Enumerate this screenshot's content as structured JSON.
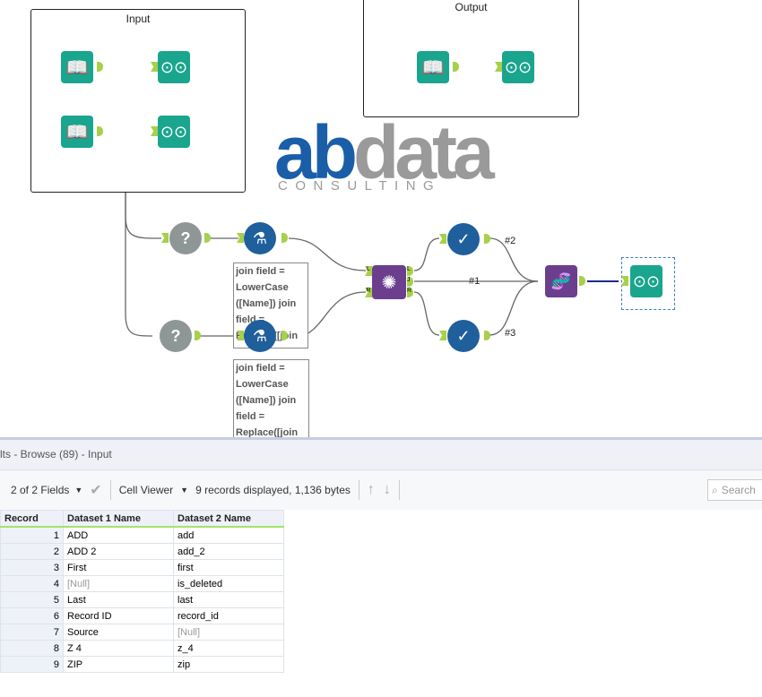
{
  "canvas": {
    "containers": [
      {
        "title": "Input"
      },
      {
        "title": "Output"
      }
    ],
    "logo": {
      "text1": "ab",
      "text2": "data",
      "sub": "CONSULTING"
    },
    "annotations": [
      "join field = LowerCase ([Name]) join field = Replace([join field],\" \",\"\")",
      "join field = LowerCase ([Name]) join field = Replace([join field],\" \",\"\")"
    ],
    "join_anchors": {
      "left": "L",
      "right": "R",
      "out_left": "L",
      "out_join": "J",
      "out_right": "R"
    },
    "connection_labels": [
      "#2",
      "#1",
      "#3"
    ]
  },
  "results": {
    "title": "lts - Browse (89) - Input",
    "fields_label": "2 of 2 Fields",
    "viewer_label": "Cell Viewer",
    "status": "9 records displayed, 1,136 bytes",
    "search_placeholder": "Search",
    "columns": [
      "Record",
      "Dataset 1 Name",
      "Dataset 2 Name"
    ],
    "rows": [
      [
        "1",
        "ADD",
        "add"
      ],
      [
        "2",
        "ADD 2",
        "add_2"
      ],
      [
        "3",
        "First",
        "first"
      ],
      [
        "4",
        "[Null]",
        "is_deleted"
      ],
      [
        "5",
        "Last",
        "last"
      ],
      [
        "6",
        "Record ID",
        "record_id"
      ],
      [
        "7",
        "Source",
        "[Null]"
      ],
      [
        "8",
        "Z 4",
        "z_4"
      ],
      [
        "9",
        "ZIP",
        "zip"
      ]
    ]
  }
}
